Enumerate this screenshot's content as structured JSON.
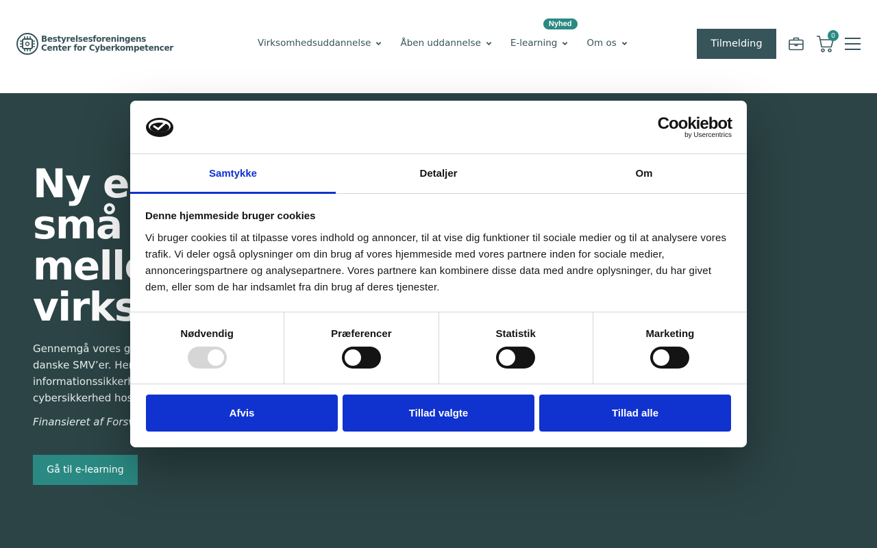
{
  "header": {
    "logo_line1": "Bestyrelsesforeningens",
    "logo_line2": "Center for Cyberkompetencer",
    "nav": [
      {
        "label": "Virksomhedsuddannelse"
      },
      {
        "label": "Åben uddannelse"
      },
      {
        "label": "E-learning",
        "badge": "Nyhed"
      },
      {
        "label": "Om os"
      }
    ],
    "signup_label": "Tilmelding",
    "cart_count": "0",
    "icons": [
      "briefcase-icon",
      "cart-icon",
      "menu-icon"
    ]
  },
  "hero": {
    "title": "Ny e-\nsmå o\nmelle\nvirkso",
    "text": "Gennemgå vores gra\ndanske SMV’er. Her\ninformationssikkerh\ncybersikkerhed hos",
    "financed": "Finansieret af Forsva",
    "cta": "Gå til e-learning"
  },
  "cookie_dialog": {
    "brand": "Cookiebot",
    "brand_sub": "by Usercentrics",
    "tabs": [
      {
        "label": "Samtykke",
        "active": true
      },
      {
        "label": "Detaljer",
        "active": false
      },
      {
        "label": "Om",
        "active": false
      }
    ],
    "heading": "Denne hjemmeside bruger cookies",
    "body": "Vi bruger cookies til at tilpasse vores indhold og annoncer, til at vise dig funktioner til sociale medier og til at analysere vores trafik. Vi deler også oplysninger om din brug af vores hjemmeside med vores partnere inden for sociale medier, annonceringspartnere og analysepartnere. Vores partnere kan kombinere disse data med andre oplysninger, du har givet dem, eller som de har indsamlet fra din brug af deres tjenester.",
    "toggles": [
      {
        "label": "Nødvendig",
        "on": true,
        "disabled": true
      },
      {
        "label": "Præferencer",
        "on": false
      },
      {
        "label": "Statistik",
        "on": false
      },
      {
        "label": "Marketing",
        "on": false
      }
    ],
    "buttons": {
      "reject": "Afvis",
      "allow_selected": "Tillad valgte",
      "allow_all": "Tillad alle"
    }
  },
  "colors": {
    "hero_bg": "#2c4446",
    "primary_teal": "#2a8a83",
    "dark_teal": "#37545a",
    "cookiebot_blue": "#1032cf"
  }
}
